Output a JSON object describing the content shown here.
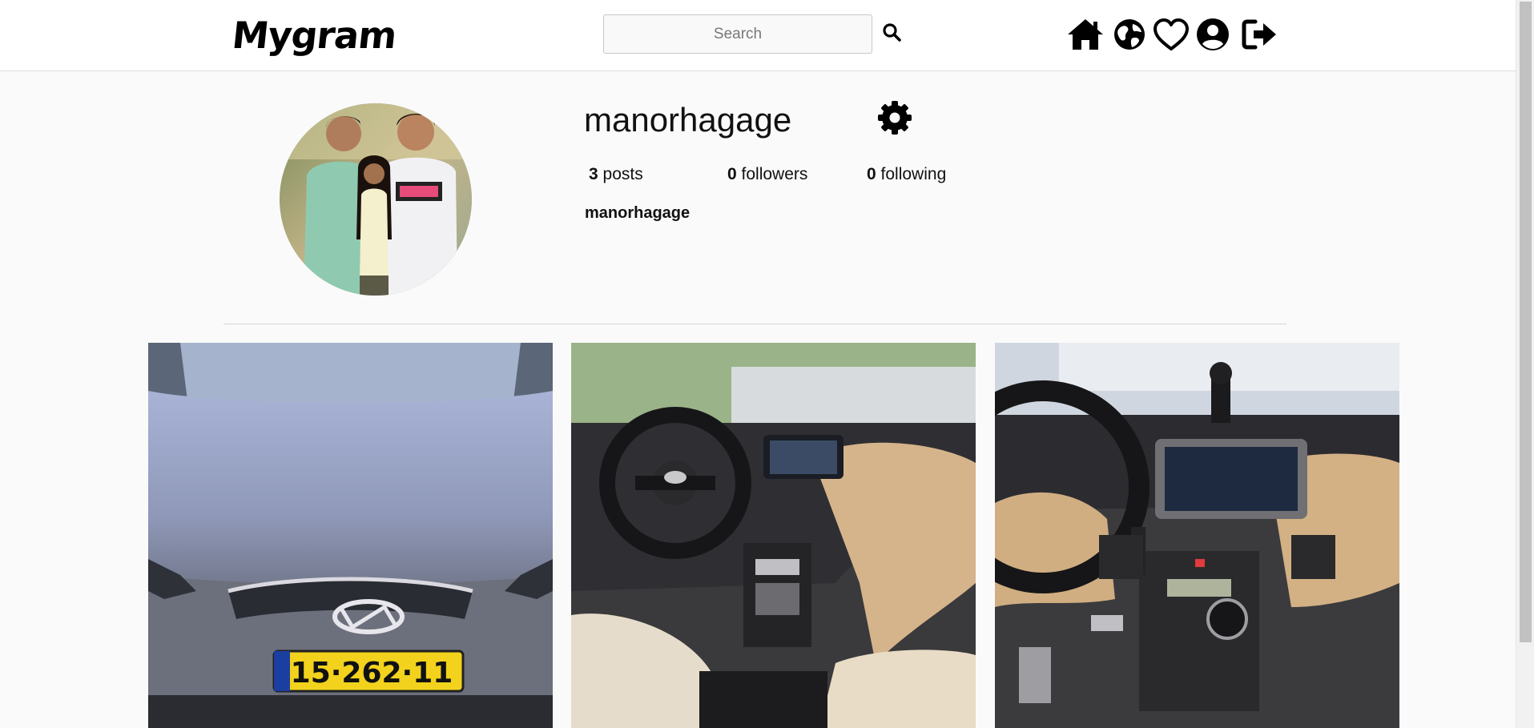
{
  "navbar": {
    "logo": "Mygram",
    "search": {
      "placeholder": "Search",
      "value": ""
    },
    "icons": [
      "search-icon",
      "home-icon",
      "globe-icon",
      "heart-icon",
      "user-icon",
      "logout-icon"
    ]
  },
  "profile": {
    "username": "manorhagage",
    "full_name": "manorhagage",
    "stats": {
      "posts_count": "3",
      "posts_label": "posts",
      "followers_count": "0",
      "followers_label": "followers",
      "following_count": "0",
      "following_label": "following"
    }
  },
  "posts": [
    {
      "subject": "car-front-photo",
      "license_plate": "15·262·11"
    },
    {
      "subject": "car-interior-steering-wheel-photo"
    },
    {
      "subject": "car-interior-dashboard-photo"
    }
  ],
  "colors": {
    "navbar_bg": "#ffffff",
    "page_bg": "#fafafa",
    "text": "#111111"
  }
}
